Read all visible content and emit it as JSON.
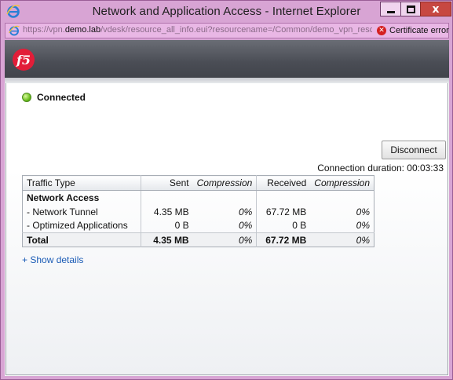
{
  "window": {
    "title": "Network and Application Access - Internet Explorer",
    "controls": {
      "minimize": "minimize",
      "maximize": "maximize",
      "close": "x"
    }
  },
  "address_bar": {
    "url_prefix": "https://vpn.",
    "url_domain": "demo.lab",
    "url_suffix": "/vdesk/resource_all_info.eui?resourcename=/Common/demo_vpn_resour",
    "cert_error": "Certificate error"
  },
  "header": {
    "logo_icon": "f5-logo"
  },
  "status": {
    "label": "Connected",
    "color": "#6bbf1f"
  },
  "disconnect_label": "Disconnect",
  "connection_duration": "Connection duration: 00:03:33",
  "table": {
    "headers": {
      "type": "Traffic Type",
      "sent": "Sent",
      "sent_compression": "Compression",
      "received": "Received",
      "received_compression": "Compression"
    },
    "group_label": "Network Access",
    "rows": [
      {
        "type": " - Network Tunnel",
        "sent": "4.35 MB",
        "sent_comp": "0%",
        "received": "67.72 MB",
        "recv_comp": "0%"
      },
      {
        "type": " - Optimized Applications",
        "sent": "0 B",
        "sent_comp": "0%",
        "received": "0 B",
        "recv_comp": "0%"
      }
    ],
    "total": {
      "type": "Total",
      "sent": "4.35 MB",
      "sent_comp": "0%",
      "received": "67.72 MB",
      "recv_comp": "0%"
    }
  },
  "show_details": "+ Show details",
  "colors": {
    "titlebar": "#d8a4d4",
    "header": "#4a4d55",
    "link": "#1a5bb5",
    "close": "#c74841"
  }
}
